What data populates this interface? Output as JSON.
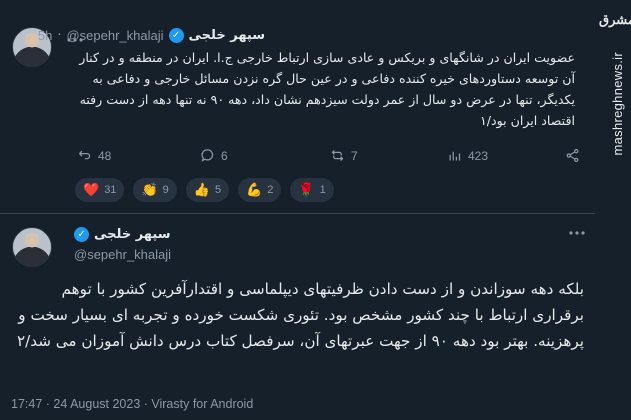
{
  "watermark": {
    "logo": "مشرق",
    "url": "mashreghnews.ir"
  },
  "tweet1": {
    "name": "سپهر خلجی",
    "handle": "@sepehr_khalaji",
    "time": "5h",
    "text": "عضویت ایران در شانگهای و بریکس و عادی سازی ارتباط خارجی ج.ا. ایران در منطقه و در کنار آن توسعه دستاوردهای خیره کننده دفاعی و در عین حال گره نزدن مسائل خارجی و دفاعی به یکدیگر، تنها در عرض دو سال از عمر دولت سیزدهم نشان داد، دهه ۹۰ نه تنها دهه از دست رفته اقتصاد ایران بود/۱",
    "actions": {
      "replies": "48",
      "comments": "6",
      "retweets": "7",
      "views": "423"
    },
    "reactions": [
      {
        "icon": "heart-icon",
        "emoji": "❤️",
        "count": "31"
      },
      {
        "icon": "clap-icon",
        "emoji": "👏",
        "count": "9"
      },
      {
        "icon": "thumbs-up-icon",
        "emoji": "👍",
        "count": "5"
      },
      {
        "icon": "muscle-icon",
        "emoji": "💪",
        "count": "2"
      },
      {
        "icon": "rose-icon",
        "emoji": "🌹",
        "count": "1"
      }
    ]
  },
  "tweet2": {
    "name": "سپهر خلجی",
    "handle": "@sepehr_khalaji",
    "text": "بلکه دهه  سوزاندن و از دست دادن ظرفیتهای دیپلماسی و اقتدارآفرین کشور با توهم برقراری ارتباط با چند کشور مشخص بود. تئوری شکست خورده و تجربه ای بسیار سخت و پرهزینه. بهتر بود دهه ۹۰ از جهت عبرتهای آن، سرفصل کتاب درس دانش آموزان می شد/۲",
    "meta": "17:47 · 24 August 2023 · Virasty for Android"
  },
  "colors": {
    "background": "#15202b",
    "accent": "#1d9bf0",
    "muted": "#8b98a5",
    "pill": "#273340"
  }
}
